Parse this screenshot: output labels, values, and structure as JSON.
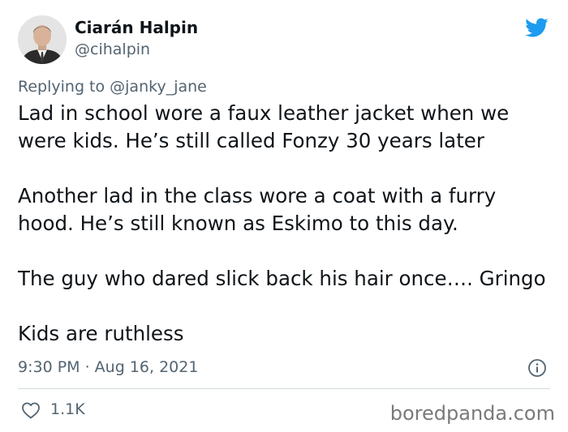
{
  "author": {
    "name": "Ciarán Halpin",
    "handle": "@cihalpin"
  },
  "reply": {
    "text": "Replying to @janky_jane"
  },
  "tweet": {
    "paragraphs": [
      "Lad in school wore a faux leather jacket when we were kids. He’s still called Fonzy 30 years later",
      "Another lad in the class wore a coat with a furry hood. He’s still known as Eskimo to this day.",
      "The guy who dared slick back his hair once…. Gringo",
      "Kids are ruthless"
    ],
    "timestamp": "9:30 PM · Aug 16, 2021"
  },
  "actions": {
    "like_count": "1.1K"
  },
  "icons": {
    "brand": "twitter-bird-icon",
    "info": "info-icon",
    "like": "heart-icon"
  },
  "colors": {
    "brand": "#1d9bf0",
    "text": "#0f1419",
    "secondary": "#536471"
  },
  "watermark": "boredpanda.com"
}
